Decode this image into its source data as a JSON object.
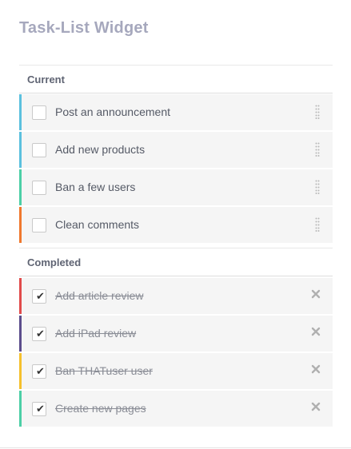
{
  "widget": {
    "title": "Task-List Widget"
  },
  "current": {
    "heading": "Current",
    "tasks": [
      {
        "label": "Post an announcement",
        "color": "#5bc0de",
        "checked": false
      },
      {
        "label": "Add new products",
        "color": "#5bc0de",
        "checked": false
      },
      {
        "label": "Ban a few users",
        "color": "#4ccfa6",
        "checked": false
      },
      {
        "label": "Clean comments",
        "color": "#f0782d",
        "checked": false
      }
    ]
  },
  "completed": {
    "heading": "Completed",
    "tasks": [
      {
        "label": "Add article review",
        "color": "#e14b4b",
        "checked": true
      },
      {
        "label": "Add iPad review",
        "color": "#5c4d8c",
        "checked": true
      },
      {
        "label": "Ban THATuser user",
        "color": "#f5c02c",
        "checked": true
      },
      {
        "label": "Create new pages",
        "color": "#4ccfa6",
        "checked": true
      }
    ]
  },
  "icons": {
    "check": "✔",
    "drag": "drag-handle-icon",
    "delete": "close-icon"
  }
}
